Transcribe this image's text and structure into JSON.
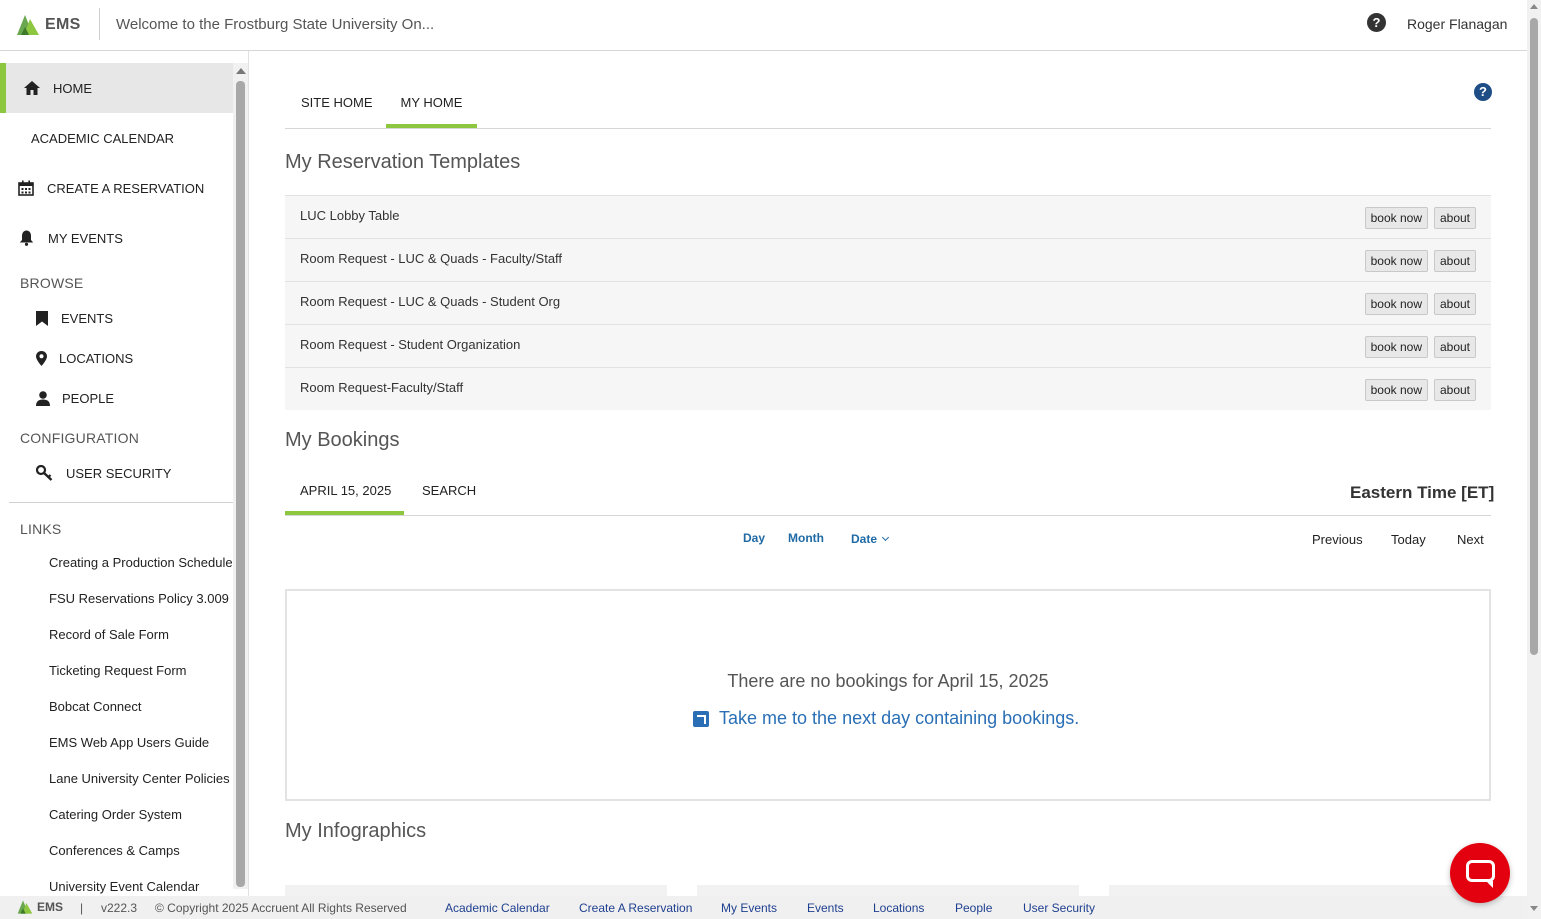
{
  "app": {
    "logo_text": "EMS",
    "welcome": "Welcome to the Frostburg State University On...",
    "user": "Roger Flanagan",
    "help_glyph": "?"
  },
  "sidebar": {
    "home": "HOME",
    "academic_calendar": "ACADEMIC CALENDAR",
    "create_reservation": "CREATE A RESERVATION",
    "my_events": "MY EVENTS",
    "browse_heading": "BROWSE",
    "events": "EVENTS",
    "locations": "LOCATIONS",
    "people": "PEOPLE",
    "configuration_heading": "CONFIGURATION",
    "user_security": "USER SECURITY",
    "links_heading": "LINKS",
    "links": [
      "Creating a Production Schedule",
      "FSU Reservations Policy 3.009",
      "Record of Sale Form",
      "Ticketing Request Form",
      "Bobcat Connect",
      "EMS Web App Users Guide",
      "Lane University Center Policies",
      "Catering Order System",
      "Conferences & Camps",
      "University Event Calendar"
    ]
  },
  "tabs": {
    "site_home": "SITE HOME",
    "my_home": "MY HOME"
  },
  "templates": {
    "heading": "My Reservation Templates",
    "book_label": "book now",
    "about_label": "about",
    "items": [
      "LUC Lobby Table",
      "Room Request - LUC & Quads - Faculty/Staff",
      "Room Request - LUC & Quads - Student Org",
      "Room Request - Student Organization",
      "Room Request-Faculty/Staff"
    ]
  },
  "bookings": {
    "heading": "My Bookings",
    "date_tab": "APRIL 15, 2025",
    "search_tab": "SEARCH",
    "timezone": "Eastern Time [ET]",
    "view_day": "Day",
    "view_month": "Month",
    "view_date": "Date",
    "previous": "Previous",
    "today": "Today",
    "next": "Next",
    "empty_message": "There are no bookings for April 15, 2025",
    "next_day_link": "Take me to the next day containing bookings."
  },
  "infographics": {
    "heading": "My Infographics"
  },
  "footer": {
    "logo_text": "EMS",
    "separator": "|",
    "version": "v222.3",
    "copyright": "© Copyright 2025 Accruent All Rights Reserved",
    "links": [
      "Academic Calendar",
      "Create A Reservation",
      "My Events",
      "Events",
      "Locations",
      "People",
      "User Security"
    ]
  },
  "colors": {
    "accent": "#8dc63f",
    "link": "#1f6aa5",
    "chat": "#e3000f"
  },
  "icons": [
    "home-icon",
    "calendar-icon",
    "bell-icon",
    "bookmark-icon",
    "map-marker-icon",
    "user-icon",
    "key-icon",
    "help-icon",
    "external-link-icon",
    "chat-icon"
  ]
}
